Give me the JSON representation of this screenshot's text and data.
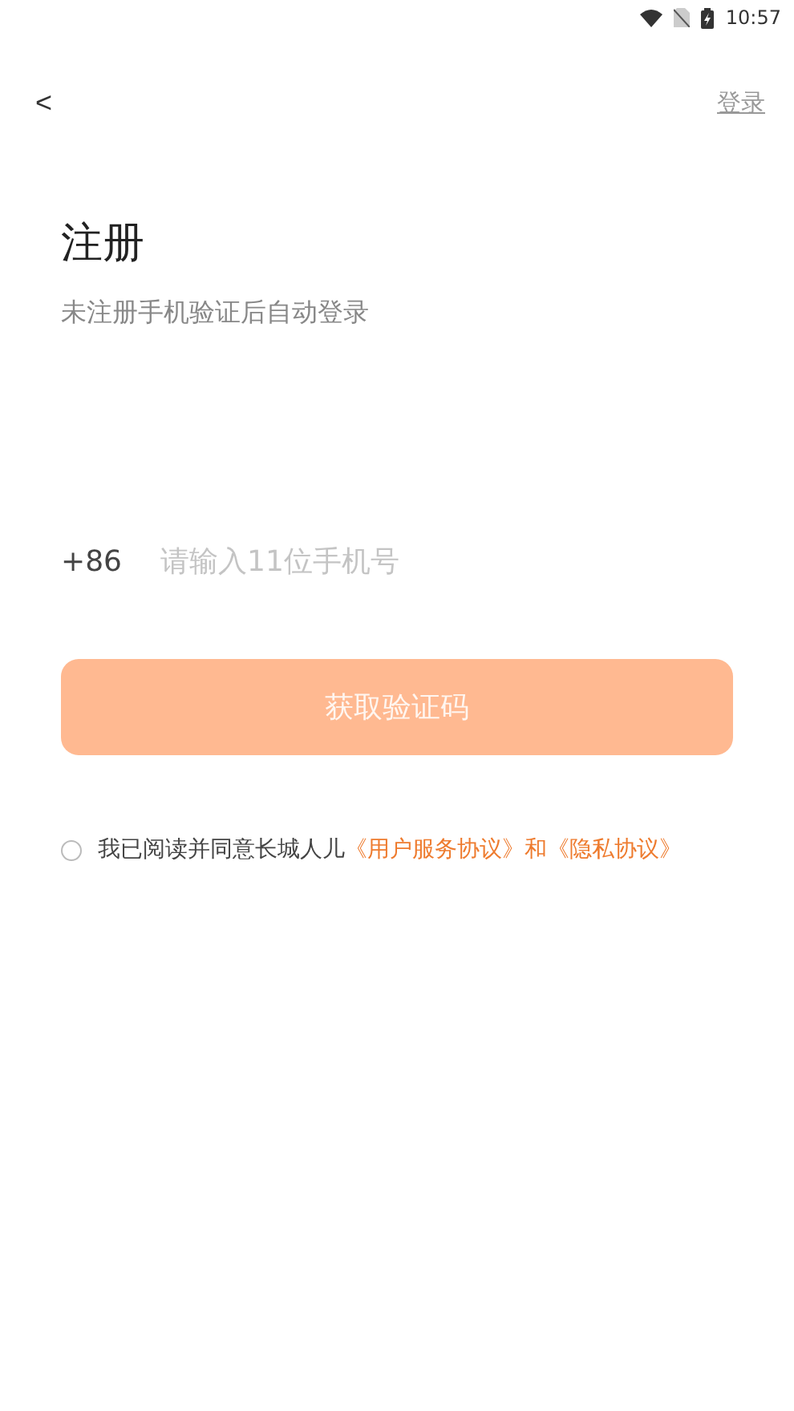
{
  "status_bar": {
    "time": "10:57"
  },
  "header": {
    "back": "<",
    "login_link": "登录"
  },
  "title": "注册",
  "subtitle": "未注册手机验证后自动登录",
  "phone": {
    "country_code": "+86",
    "placeholder": "请输入11位手机号"
  },
  "submit_button": {
    "label": "获取验证码",
    "disabled": true
  },
  "agreement": {
    "checked": false,
    "text": "我已阅读并同意长城人儿",
    "link_1": "《用户服务协议》",
    "joiner": "和",
    "link_2": "《隐私协议》"
  }
}
